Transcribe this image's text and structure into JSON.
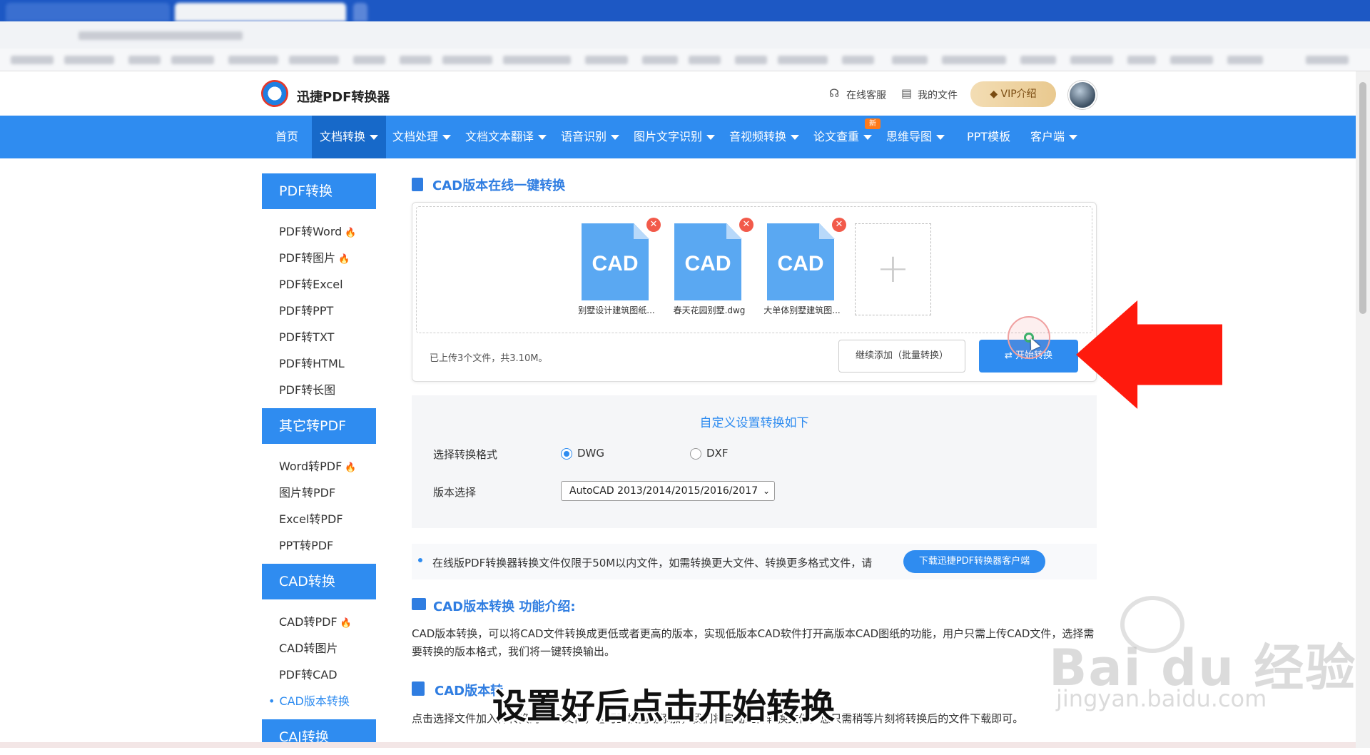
{
  "browser": {
    "tab_count": 2
  },
  "header": {
    "logo_text": "迅捷PDF转换器",
    "service": "在线客服",
    "my_files": "我的文件",
    "vip": "VIP介绍"
  },
  "nav": {
    "items": [
      {
        "label": "首页",
        "caret": false
      },
      {
        "label": "文档转换",
        "caret": true,
        "active": true
      },
      {
        "label": "文档处理",
        "caret": true
      },
      {
        "label": "文档文本翻译",
        "caret": true
      },
      {
        "label": "语音识别",
        "caret": true
      },
      {
        "label": "图片文字识别",
        "caret": true
      },
      {
        "label": "音视频转换",
        "caret": true
      },
      {
        "label": "论文查重",
        "caret": true
      },
      {
        "label": "思维导图",
        "caret": true
      },
      {
        "label": "PPT模板",
        "caret": false
      },
      {
        "label": "客户端",
        "caret": true
      }
    ],
    "new_badge": "新"
  },
  "sidebar": {
    "pdf_convert": {
      "title": "PDF转换",
      "items": [
        "PDF转Word",
        "PDF转图片",
        "PDF转Excel",
        "PDF转PPT",
        "PDF转TXT",
        "PDF转HTML",
        "PDF转长图"
      ]
    },
    "other_to_pdf": {
      "title": "其它转PDF",
      "items": [
        "Word转PDF",
        "图片转PDF",
        "Excel转PDF",
        "PPT转PDF"
      ]
    },
    "cad_convert": {
      "title": "CAD转换",
      "items": [
        "CAD转PDF",
        "CAD转图片",
        "PDF转CAD",
        "CAD版本转换"
      ]
    },
    "caj_convert": {
      "title": "CAJ转换"
    }
  },
  "main": {
    "section_title": "CAD版本在线一键转换",
    "files": [
      {
        "label": "CAD",
        "name": "别墅设计建筑图纸..."
      },
      {
        "label": "CAD",
        "name": "春天花园别墅.dwg"
      },
      {
        "label": "CAD",
        "name": "大单体别墅建筑图..."
      }
    ],
    "add_symbol": "+",
    "upload_status": "已上传3个文件，共3.10M。",
    "continue_button": "继续添加（批量转换）",
    "start_button": "开始转换",
    "settings": {
      "title": "自定义设置转换如下",
      "format_label": "选择转换格式",
      "format_options": [
        "DWG",
        "DXF"
      ],
      "format_selected": "DWG",
      "version_label": "版本选择",
      "version_value": "AutoCAD 2013/2014/2015/2016/2017"
    },
    "notice": "在线版PDF转换器转换文件仅限于50M以内文件，如需转换更大文件、转换更多格式文件，请",
    "download_button": "下载迅捷PDF转换器客户端",
    "intro_title": "CAD版本转换 功能介绍:",
    "intro_text": "CAD版本转换，可以将CAD文件转换成更低或者更高的版本，实现低版本CAD软件打开高版本CAD图纸的功能，用户只需上传CAD文件，选择需要转换的版本格式，我们将一键转换输出。",
    "steps_title": "CAD版本转",
    "steps_text": "点击选择文件加入待转换的CAD文件，也可直接拖动添加，我们将自动上传转换文件，您只需稍等片刻将转换后的文件下载即可。"
  },
  "overlay": {
    "subtitle": "设置好后点击开始转换",
    "watermark_main": "Bai du 经验",
    "watermark_sub": "jingyan.baidu.com"
  },
  "colors": {
    "brand_blue": "#2f8cf0",
    "arrow_red": "#ff1a0d",
    "fire_orange": "#ff7a1a"
  }
}
